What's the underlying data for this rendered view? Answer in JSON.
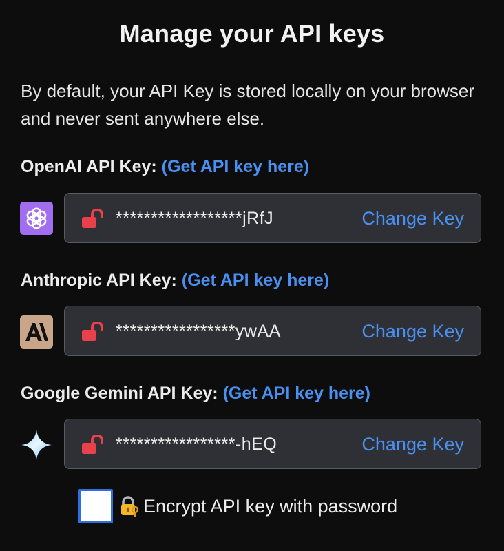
{
  "title": "Manage your API keys",
  "description": "By default, your API Key is stored locally on your browser and never sent anywhere else.",
  "providers": [
    {
      "label": "OpenAI API Key:",
      "link_text": "(Get API key here)",
      "masked_key": "******************jRfJ",
      "change_label": "Change Key",
      "logo_icon": "openai-logo-icon",
      "logo_bg": "#a16ef0"
    },
    {
      "label": "Anthropic API Key:",
      "link_text": "(Get API key here)",
      "masked_key": "*****************ywAA",
      "change_label": "Change Key",
      "logo_icon": "anthropic-logo-icon",
      "logo_bg": "#c9a58a"
    },
    {
      "label": "Google Gemini API Key:",
      "link_text": "(Get API key here)",
      "masked_key": "*****************-hEQ",
      "change_label": "Change Key",
      "logo_icon": "gemini-logo-icon",
      "logo_bg": ""
    }
  ],
  "encrypt": {
    "label": "Encrypt API key with password",
    "checked": false,
    "icon": "locked-with-key-icon"
  },
  "colors": {
    "background": "#0d0d0d",
    "link": "#4a90f0",
    "lock": "#e8414b",
    "input_bg": "#2f3035"
  }
}
